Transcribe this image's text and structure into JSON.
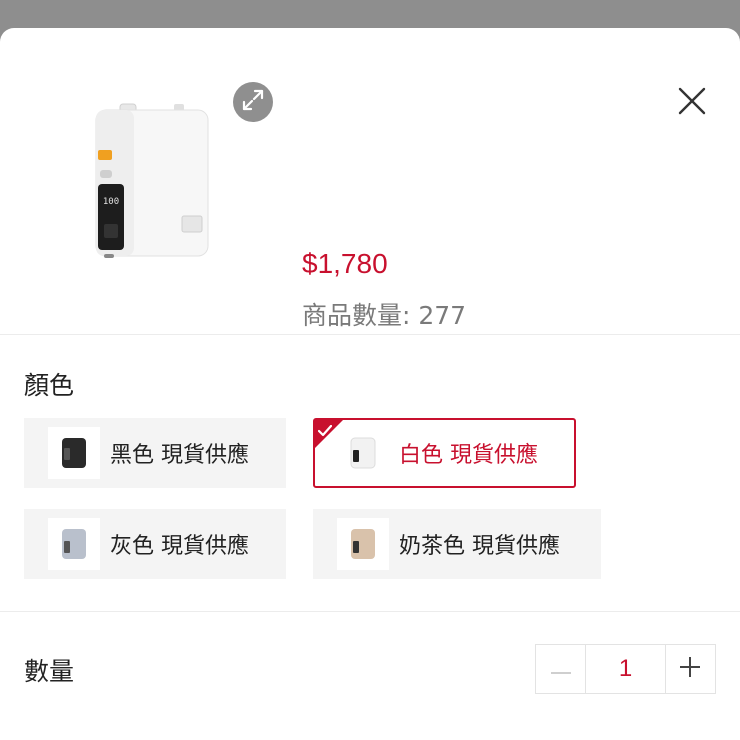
{
  "product": {
    "price": "$1,780",
    "stock_label": "商品數量:",
    "stock_count": "277"
  },
  "color_section": {
    "title": "顏色",
    "selected_index": 1,
    "options": [
      {
        "label": "黑色 現貨供應",
        "swatch": "#2a2a2a"
      },
      {
        "label": "白色 現貨供應",
        "swatch": "#f2f2f2"
      },
      {
        "label": "灰色 現貨供應",
        "swatch": "#b9c0cc"
      },
      {
        "label": "奶茶色 現貨供應",
        "swatch": "#d9c2ab"
      }
    ]
  },
  "quantity_section": {
    "title": "數量",
    "value": "1",
    "minus_symbol": "−",
    "plus_symbol": "+"
  },
  "colors": {
    "accent": "#c8102e",
    "overlay": "#8e8e8e"
  }
}
